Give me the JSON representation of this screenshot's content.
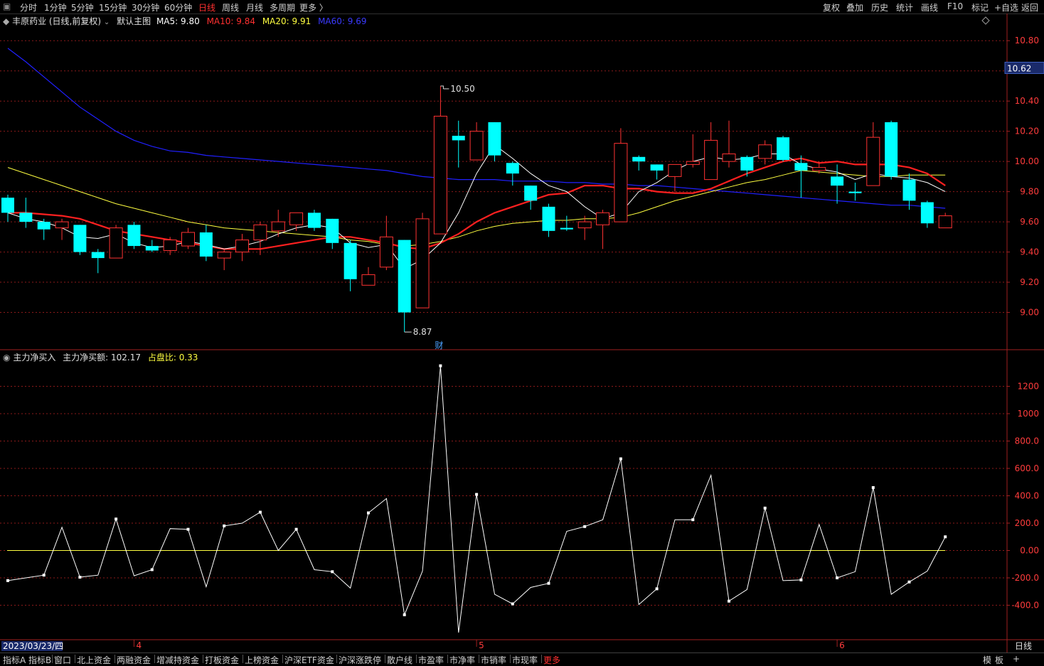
{
  "topbar": {
    "left": [
      "分时",
      "1分钟",
      "5分钟",
      "15分钟",
      "30分钟",
      "60分钟",
      "日线",
      "周线",
      "月线",
      "多周期",
      "更多 〉"
    ],
    "active": "日线",
    "right": [
      "复权",
      "叠加",
      "历史",
      "统计",
      "画线",
      "F10",
      "标记",
      "+自选",
      "返回"
    ]
  },
  "main_header": {
    "stock": "丰原药业 (日线,前复权)",
    "template": "默认主图",
    "ma5": "MA5: 9.80",
    "ma10": "MA10: 9.84",
    "ma20": "MA20: 9.91",
    "ma60": "MA60: 9.69"
  },
  "sub_header": {
    "name": "主力净买入",
    "net": "主力净买额: 102.17",
    "ratio": "占盘比: 0.33"
  },
  "annotations": {
    "high_label": "10.50",
    "low_label": "8.87",
    "current_price": "10.62",
    "cai_marker": "财"
  },
  "x_axis": {
    "date_label": "2023/03/23/四",
    "months": [
      "4",
      "5",
      "6"
    ],
    "period": "日线"
  },
  "bottom_bar": {
    "items": [
      "指标A",
      "指标B",
      "窗口",
      "北上资金",
      "两融资金",
      "增减持资金",
      "打板资金",
      "上榜资金",
      "沪深ETF资金",
      "沪深涨跌停",
      "散户线",
      "市盈率",
      "市净率",
      "市销率",
      "市现率",
      "更多"
    ],
    "active": "更多",
    "right": [
      "模",
      "板",
      "+"
    ]
  },
  "colors": {
    "up": "#ff3232",
    "down": "#00ffff",
    "ma5": "#ffffff",
    "ma10": "#ff2020",
    "ma20": "#ffff40",
    "ma60": "#2020ff",
    "grid": "#8b1a1a",
    "netbuy_line": "#ffffff",
    "zero_line": "#ffff40"
  },
  "chart_data": [
    {
      "type": "candlestick",
      "title": "丰原药业 (日线,前复权)",
      "y_ticks": [
        "10.80",
        "10.60",
        "10.40",
        "10.20",
        "10.00",
        "9.80",
        "9.60",
        "9.40",
        "9.20",
        "9.00"
      ],
      "ylim": [
        8.8,
        10.9
      ],
      "candles": [
        {
          "o": 9.76,
          "h": 9.78,
          "l": 9.6,
          "c": 9.66
        },
        {
          "o": 9.66,
          "h": 9.76,
          "l": 9.56,
          "c": 9.6
        },
        {
          "o": 9.6,
          "h": 9.62,
          "l": 9.48,
          "c": 9.55
        },
        {
          "o": 9.56,
          "h": 9.62,
          "l": 9.48,
          "c": 9.6
        },
        {
          "o": 9.58,
          "h": 9.58,
          "l": 9.38,
          "c": 9.4
        },
        {
          "o": 9.4,
          "h": 9.42,
          "l": 9.26,
          "c": 9.36
        },
        {
          "o": 9.36,
          "h": 9.58,
          "l": 9.36,
          "c": 9.56
        },
        {
          "o": 9.58,
          "h": 9.6,
          "l": 9.42,
          "c": 9.44
        },
        {
          "o": 9.44,
          "h": 9.48,
          "l": 9.4,
          "c": 9.41
        },
        {
          "o": 9.41,
          "h": 9.5,
          "l": 9.38,
          "c": 9.48
        },
        {
          "o": 9.44,
          "h": 9.56,
          "l": 9.42,
          "c": 9.53
        },
        {
          "o": 9.53,
          "h": 9.58,
          "l": 9.34,
          "c": 9.37
        },
        {
          "o": 9.36,
          "h": 9.42,
          "l": 9.28,
          "c": 9.4
        },
        {
          "o": 9.4,
          "h": 9.52,
          "l": 9.34,
          "c": 9.48
        },
        {
          "o": 9.48,
          "h": 9.6,
          "l": 9.38,
          "c": 9.58
        },
        {
          "o": 9.54,
          "h": 9.68,
          "l": 9.5,
          "c": 9.6
        },
        {
          "o": 9.58,
          "h": 9.66,
          "l": 9.54,
          "c": 9.66
        },
        {
          "o": 9.66,
          "h": 9.68,
          "l": 9.54,
          "c": 9.56
        },
        {
          "o": 9.62,
          "h": 9.62,
          "l": 9.42,
          "c": 9.46
        },
        {
          "o": 9.46,
          "h": 9.48,
          "l": 9.14,
          "c": 9.22
        },
        {
          "o": 9.18,
          "h": 9.3,
          "l": 9.18,
          "c": 9.25
        },
        {
          "o": 9.3,
          "h": 9.64,
          "l": 9.28,
          "c": 9.5
        },
        {
          "o": 9.48,
          "h": 9.48,
          "l": 8.87,
          "c": 9.0
        },
        {
          "o": 9.03,
          "h": 9.66,
          "l": 9.03,
          "c": 9.62
        },
        {
          "o": 9.52,
          "h": 10.5,
          "l": 9.52,
          "c": 10.3
        },
        {
          "o": 10.17,
          "h": 10.27,
          "l": 9.96,
          "c": 10.14
        },
        {
          "o": 10.01,
          "h": 10.26,
          "l": 10.01,
          "c": 10.2
        },
        {
          "o": 10.26,
          "h": 10.26,
          "l": 10.0,
          "c": 10.04
        },
        {
          "o": 9.99,
          "h": 10.0,
          "l": 9.84,
          "c": 9.92
        },
        {
          "o": 9.84,
          "h": 9.84,
          "l": 9.68,
          "c": 9.74
        },
        {
          "o": 9.7,
          "h": 9.72,
          "l": 9.5,
          "c": 9.54
        },
        {
          "o": 9.56,
          "h": 9.64,
          "l": 9.54,
          "c": 9.55
        },
        {
          "o": 9.56,
          "h": 9.64,
          "l": 9.48,
          "c": 9.6
        },
        {
          "o": 9.58,
          "h": 9.68,
          "l": 9.42,
          "c": 9.66
        },
        {
          "o": 9.6,
          "h": 10.22,
          "l": 9.6,
          "c": 10.12
        },
        {
          "o": 10.03,
          "h": 10.04,
          "l": 9.94,
          "c": 10.0
        },
        {
          "o": 9.98,
          "h": 9.98,
          "l": 9.88,
          "c": 9.94
        },
        {
          "o": 9.9,
          "h": 9.98,
          "l": 9.8,
          "c": 9.98
        },
        {
          "o": 9.98,
          "h": 10.18,
          "l": 9.96,
          "c": 10.0
        },
        {
          "o": 9.88,
          "h": 10.26,
          "l": 9.88,
          "c": 10.14
        },
        {
          "o": 10.0,
          "h": 10.27,
          "l": 9.96,
          "c": 10.05
        },
        {
          "o": 10.03,
          "h": 10.04,
          "l": 9.9,
          "c": 9.94
        },
        {
          "o": 10.02,
          "h": 10.14,
          "l": 9.98,
          "c": 10.11
        },
        {
          "o": 10.16,
          "h": 10.17,
          "l": 10.0,
          "c": 10.01
        },
        {
          "o": 9.99,
          "h": 10.04,
          "l": 9.76,
          "c": 9.94
        },
        {
          "o": 9.94,
          "h": 10.0,
          "l": 9.92,
          "c": 9.96
        },
        {
          "o": 9.9,
          "h": 9.98,
          "l": 9.72,
          "c": 9.84
        },
        {
          "o": 9.8,
          "h": 9.86,
          "l": 9.74,
          "c": 9.79
        },
        {
          "o": 9.84,
          "h": 10.26,
          "l": 9.84,
          "c": 10.16
        },
        {
          "o": 10.26,
          "h": 10.27,
          "l": 9.88,
          "c": 9.9
        },
        {
          "o": 9.88,
          "h": 9.92,
          "l": 9.68,
          "c": 9.74
        },
        {
          "o": 9.73,
          "h": 9.74,
          "l": 9.56,
          "c": 9.59
        },
        {
          "o": 9.56,
          "h": 9.66,
          "l": 9.56,
          "c": 9.64
        }
      ],
      "ma5": [
        9.66,
        9.62,
        9.6,
        9.56,
        9.5,
        9.49,
        9.52,
        9.46,
        9.43,
        9.44,
        9.47,
        9.45,
        9.42,
        9.44,
        9.47,
        9.52,
        9.56,
        9.58,
        9.56,
        9.46,
        9.43,
        9.45,
        9.29,
        9.35,
        9.46,
        9.66,
        9.92,
        10.11,
        10.02,
        9.92,
        9.84,
        9.8,
        9.7,
        9.62,
        9.66,
        9.8,
        9.86,
        9.94,
        10.0,
        10.03,
        10.01,
        10.02,
        10.05,
        10.05,
        9.98,
        9.95,
        9.93,
        9.88,
        9.92,
        9.9,
        9.89,
        9.86,
        9.8
      ],
      "ma10": [
        9.66,
        9.66,
        9.65,
        9.64,
        9.62,
        9.58,
        9.54,
        9.52,
        9.5,
        9.48,
        9.46,
        9.44,
        9.42,
        9.42,
        9.42,
        9.44,
        9.46,
        9.48,
        9.5,
        9.5,
        9.48,
        9.46,
        9.43,
        9.42,
        9.46,
        9.52,
        9.6,
        9.66,
        9.7,
        9.74,
        9.78,
        9.79,
        9.84,
        9.84,
        9.82,
        9.82,
        9.8,
        9.79,
        9.79,
        9.82,
        9.87,
        9.92,
        9.96,
        10.0,
        10.02,
        9.99,
        10.0,
        9.98,
        9.98,
        9.98,
        9.96,
        9.92,
        9.84
      ],
      "ma20": [
        9.96,
        9.92,
        9.88,
        9.84,
        9.8,
        9.76,
        9.72,
        9.69,
        9.66,
        9.63,
        9.6,
        9.58,
        9.56,
        9.55,
        9.54,
        9.53,
        9.52,
        9.51,
        9.5,
        9.48,
        9.47,
        9.45,
        9.44,
        9.45,
        9.47,
        9.5,
        9.54,
        9.57,
        9.59,
        9.6,
        9.61,
        9.61,
        9.62,
        9.62,
        9.63,
        9.66,
        9.7,
        9.74,
        9.77,
        9.8,
        9.83,
        9.86,
        9.88,
        9.91,
        9.94,
        9.93,
        9.92,
        9.91,
        9.9,
        9.9,
        9.91,
        9.91,
        9.91
      ],
      "ma60": [
        10.75,
        10.66,
        10.56,
        10.46,
        10.36,
        10.28,
        10.2,
        10.14,
        10.1,
        10.07,
        10.06,
        10.04,
        10.03,
        10.02,
        10.01,
        10.0,
        9.99,
        9.98,
        9.97,
        9.96,
        9.95,
        9.94,
        9.92,
        9.9,
        9.89,
        9.88,
        9.88,
        9.88,
        9.87,
        9.87,
        9.87,
        9.86,
        9.86,
        9.85,
        9.85,
        9.84,
        9.84,
        9.83,
        9.82,
        9.81,
        9.8,
        9.79,
        9.78,
        9.77,
        9.76,
        9.75,
        9.74,
        9.73,
        9.72,
        9.71,
        9.71,
        9.7,
        9.69
      ]
    },
    {
      "type": "line",
      "title": "主力净买入",
      "y_ticks": [
        "1200",
        "1000",
        "800.0",
        "600.0",
        "400.0",
        "200.0",
        "0.00",
        "-200.0",
        "-400.0"
      ],
      "ylim": [
        -600,
        1400
      ],
      "values": [
        -220,
        -200,
        -180,
        170,
        -195,
        -180,
        230,
        -185,
        -140,
        160,
        155,
        -265,
        180,
        200,
        280,
        0,
        155,
        -140,
        -155,
        -275,
        275,
        380,
        -470,
        -150,
        1350,
        -600,
        410,
        -320,
        -390,
        -270,
        -240,
        140,
        175,
        225,
        670,
        -395,
        -280,
        225,
        225,
        550,
        -370,
        -285,
        310,
        -220,
        -215,
        190,
        -200,
        -155,
        460,
        -320,
        -230,
        -150,
        100
      ]
    }
  ]
}
